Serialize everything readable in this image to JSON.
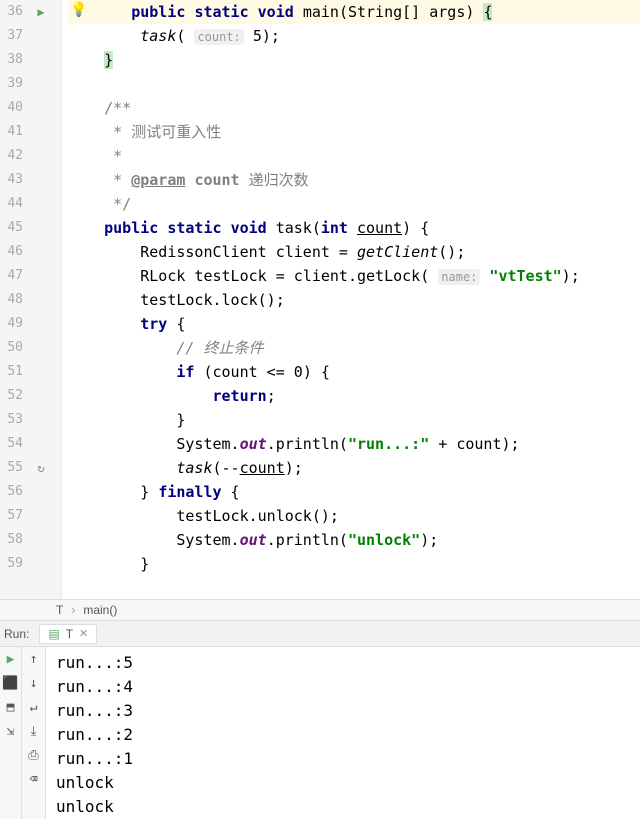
{
  "gutter": {
    "start": 36,
    "lines": [
      36,
      37,
      38,
      39,
      40,
      41,
      42,
      43,
      44,
      45,
      46,
      47,
      48,
      49,
      50,
      51,
      52,
      53,
      54,
      55,
      56,
      57,
      58,
      59
    ],
    "run_marker_line": 36,
    "bulb_line": 36,
    "recursion_line": 55
  },
  "code": {
    "l36": {
      "indent": "    ",
      "kw1": "public",
      "kw2": "static",
      "kw3": "void",
      "method": "main",
      "params_open": "(String[] args) ",
      "brace": "{"
    },
    "l37": {
      "indent": "        ",
      "fn": "task",
      "open": "( ",
      "hint": "count:",
      "arg": "5",
      "close": ");"
    },
    "l38": {
      "indent": "    ",
      "brace": "}"
    },
    "l39": {
      "text": ""
    },
    "l40": {
      "indent": "    ",
      "text": "/**"
    },
    "l41": {
      "indent": "     ",
      "star": "* ",
      "text": "测试可重入性"
    },
    "l42": {
      "indent": "     ",
      "star": "*",
      "text": ""
    },
    "l43": {
      "indent": "     ",
      "star": "* ",
      "tag": "@param",
      "arg": "count",
      "desc": " 递归次数"
    },
    "l44": {
      "indent": "     ",
      "text": "*/"
    },
    "l45": {
      "indent": "    ",
      "kw1": "public",
      "kw2": "static",
      "kw3": "void",
      "method": "task",
      "open": "(",
      "ptype": "int",
      "pname": "count",
      "close": ") {"
    },
    "l46": {
      "indent": "        ",
      "text1": "RedissonClient client = ",
      "ital": "getClient",
      "text2": "();"
    },
    "l47": {
      "indent": "        ",
      "text1": "RLock testLock = client.getLock( ",
      "hint": "name:",
      "str": "\"vtTest\"",
      "text2": ");"
    },
    "l48": {
      "indent": "        ",
      "text": "testLock.lock();"
    },
    "l49": {
      "indent": "        ",
      "kw": "try",
      "text": " {"
    },
    "l50": {
      "indent": "            ",
      "cmt": "// 终止条件"
    },
    "l51": {
      "indent": "            ",
      "kw": "if",
      "cond": " (count <= ",
      "num": "0",
      "close": ") {"
    },
    "l52": {
      "indent": "                ",
      "kw": "return",
      "semi": ";"
    },
    "l53": {
      "indent": "            ",
      "text": "}"
    },
    "l54": {
      "indent": "            ",
      "pre": "System.",
      "out": "out",
      "mid": ".println(",
      "str": "\"run...:\"",
      "post": " + count);"
    },
    "l55": {
      "indent": "            ",
      "fn": "task",
      "text": "(--",
      "arg": "count",
      "close": ");"
    },
    "l56": {
      "indent": "        ",
      "close": "} ",
      "kw": "finally",
      "open": " {"
    },
    "l57": {
      "indent": "            ",
      "text": "testLock.unlock();"
    },
    "l58": {
      "indent": "            ",
      "pre": "System.",
      "out": "out",
      "mid": ".println(",
      "str": "\"unlock\"",
      "post": ");"
    },
    "l59": {
      "indent": "        ",
      "text": "}"
    }
  },
  "breadcrumb": {
    "class": "T",
    "method": "main()"
  },
  "run_header": {
    "label": "Run:",
    "tab": "T"
  },
  "console": {
    "lines": [
      "run...:5",
      "run...:4",
      "run...:3",
      "run...:2",
      "run...:1",
      "unlock",
      "unlock"
    ]
  }
}
